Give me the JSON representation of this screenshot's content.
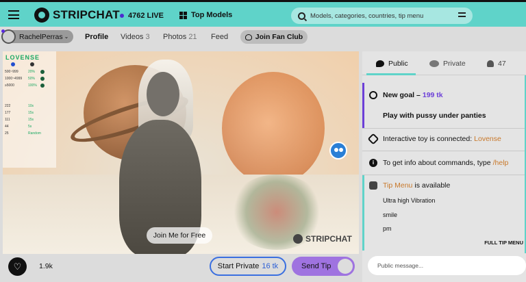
{
  "header": {
    "brand": "STRIPCHAT",
    "live_count": "4762 LIVE",
    "top_models": "Top Models",
    "search_placeholder": "Models, categories, countries, tip menu",
    "accent": "#5fd3c9"
  },
  "subnav": {
    "username": "RachelPerras",
    "tabs": [
      {
        "label": "Profile",
        "count": ""
      },
      {
        "label": "Videos",
        "count": "3"
      },
      {
        "label": "Photos",
        "count": "21"
      },
      {
        "label": "Feed",
        "count": ""
      }
    ],
    "fan_club": "Join Fan Club"
  },
  "video": {
    "lovense_title": "LOVENSE",
    "lovense_levels": [
      {
        "range": "500~999",
        "pct": "20%"
      },
      {
        "range": "1000~4999",
        "pct": "50%"
      },
      {
        "range": "≥5000",
        "pct": "100%"
      }
    ],
    "lovense_patterns": [
      {
        "value": "222",
        "time": "10s"
      },
      {
        "value": "177",
        "time": "15s"
      },
      {
        "value": "111",
        "time": "15s"
      },
      {
        "value": "44",
        "time": "5s"
      },
      {
        "value": "25",
        "time": "Random"
      }
    ],
    "join_label": "Join Me for Free",
    "watermark": "STRIPCHAT"
  },
  "controls": {
    "likes": "1.9k",
    "start_private": "Start Private",
    "private_price": "16 tk",
    "send_tip": "Send Tip"
  },
  "chat": {
    "tabs": {
      "public": "Public",
      "private": "Private",
      "users": "47"
    },
    "goal_label": "New goal –",
    "goal_amount": "199 tk",
    "goal_text": "Play with pussy under panties",
    "toy_text": "Interactive toy is connected:",
    "toy_brand": "Lovense",
    "info_text": "To get info about commands, type",
    "info_cmd": "/help",
    "tipmenu_label": "Tip Menu",
    "tipmenu_text": "is available",
    "tip_items": [
      "Ultra high Vibration",
      "smile",
      "pm"
    ],
    "full_menu": "FULL TIP MENU",
    "input_placeholder": "Public message..."
  }
}
